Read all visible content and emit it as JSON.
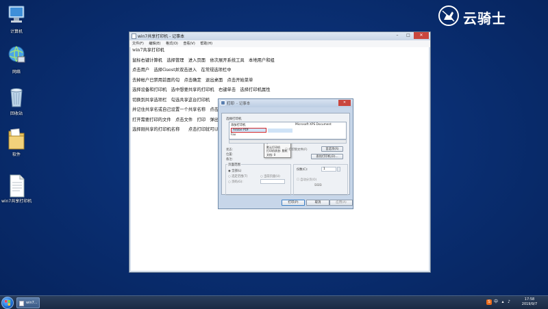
{
  "desktop": {
    "icons": [
      {
        "label": "计算机"
      },
      {
        "label": "网络"
      },
      {
        "label": "回收站"
      },
      {
        "label": "软件"
      },
      {
        "label": "win7共享打印机"
      }
    ]
  },
  "brand": {
    "name": "云骑士"
  },
  "notepad": {
    "title": "win7共享打印机 - 记事本",
    "menu": [
      "文件(F)",
      "编辑(E)",
      "格式(O)",
      "查看(V)",
      "帮助(H)"
    ],
    "controls": {
      "minimize": "–",
      "maximize": "□",
      "close": "✕"
    },
    "lines": [
      "win7共享打印机",
      "鼠标右键计算机　选择管理　进入页面　依次展开系统工具　本地用户和组",
      "点击用户　选择Guest并双击进入　在常规选项栏中",
      "去掉帐户已禁用前面的勾　点击确定　退出桌面　点击开始菜单",
      "选择设备和打印机　选中想要共享的打印机　右键单击　选择打印机属性",
      "切换到共享选项栏　勾选共享这台打印机",
      "并记住共享名或自己设置一个共享名称　点击",
      "打开需要打印的文件　点击文件　打印　弹出",
      "选择刚共享的打印机名称　　点击打印就可以"
    ]
  },
  "print_dialog": {
    "title": "打印",
    "title_extra": "- 记事本",
    "close": "✕",
    "tab": "常规",
    "select_printer_label": "选择打印机",
    "printers": [
      {
        "name": "添加打印机"
      },
      {
        "name": "Microsoft XPS Document"
      },
      {
        "name": "Adobe PDF"
      },
      {
        "name": "Fax"
      }
    ],
    "context_menu": [
      "√",
      "默认打印机",
      "打印机状态: 脱机",
      "文档: 0"
    ],
    "status_label": "状态:",
    "location_label": "位置:",
    "comment_label": "备注:",
    "print_to_file": "打印到文件(F)",
    "preferences_button": "首选项(R)",
    "find_printer_button": "查找打印机(D)...",
    "page_range_label": "页面范围",
    "all_pages": "全部(L)",
    "selection": "选定范围(T)",
    "current_page": "当前页面(U)",
    "pages": "页码(G):",
    "copies_label": "份数(C):",
    "copies_value": "1",
    "collate": "自动分页(O)",
    "print_button": "打印(P)",
    "cancel_button": "取消",
    "apply_button": "应用(A)"
  },
  "taskbar": {
    "task_label": "win7...",
    "clock_time": "17:58",
    "clock_date": "2019/9/7",
    "tray_ime": "S",
    "tray_lang": "中"
  }
}
